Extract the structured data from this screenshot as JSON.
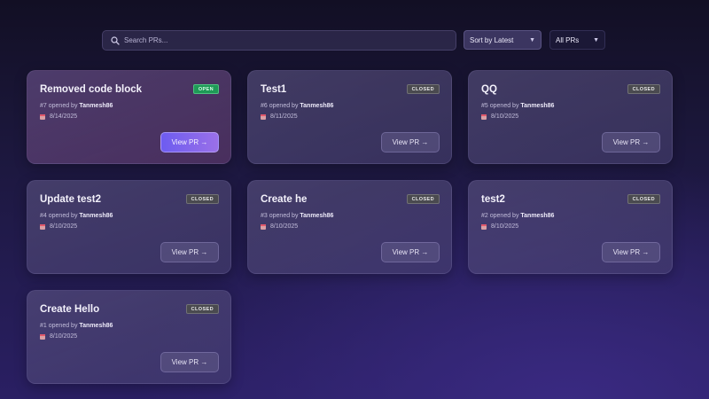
{
  "search": {
    "placeholder": "Search PRs..."
  },
  "sort": {
    "selected": "Sort by Latest"
  },
  "filter": {
    "selected": "All PRs"
  },
  "colors": {
    "open_badge": "#1f9a57",
    "closed_badge": "#4a4a4f",
    "primary_button": "#7a64ef"
  },
  "icons": {
    "search": "search-icon",
    "calendar": "calendar-icon",
    "dropdown": "chevron-down-icon"
  },
  "cards": [
    {
      "title": "Removed code block",
      "status": "OPEN",
      "number": "#7",
      "opened_by_text": "opened by",
      "author": "Tanmesh86",
      "date": "8/14/2025",
      "button": "View PR →"
    },
    {
      "title": "Test1",
      "status": "CLOSED",
      "number": "#6",
      "opened_by_text": "opened by",
      "author": "Tanmesh86",
      "date": "8/11/2025",
      "button": "View PR →"
    },
    {
      "title": "QQ",
      "status": "CLOSED",
      "number": "#5",
      "opened_by_text": "opened by",
      "author": "Tanmesh86",
      "date": "8/10/2025",
      "button": "View PR →"
    },
    {
      "title": "Update test2",
      "status": "CLOSED",
      "number": "#4",
      "opened_by_text": "opened by",
      "author": "Tanmesh86",
      "date": "8/10/2025",
      "button": "View PR →"
    },
    {
      "title": "Create he",
      "status": "CLOSED",
      "number": "#3",
      "opened_by_text": "opened by",
      "author": "Tanmesh86",
      "date": "8/10/2025",
      "button": "View PR →"
    },
    {
      "title": "test2",
      "status": "CLOSED",
      "number": "#2",
      "opened_by_text": "opened by",
      "author": "Tanmesh86",
      "date": "8/10/2025",
      "button": "View PR →"
    },
    {
      "title": "Create Hello",
      "status": "CLOSED",
      "number": "#1",
      "opened_by_text": "opened by",
      "author": "Tanmesh86",
      "date": "8/10/2025",
      "button": "View PR →"
    }
  ]
}
